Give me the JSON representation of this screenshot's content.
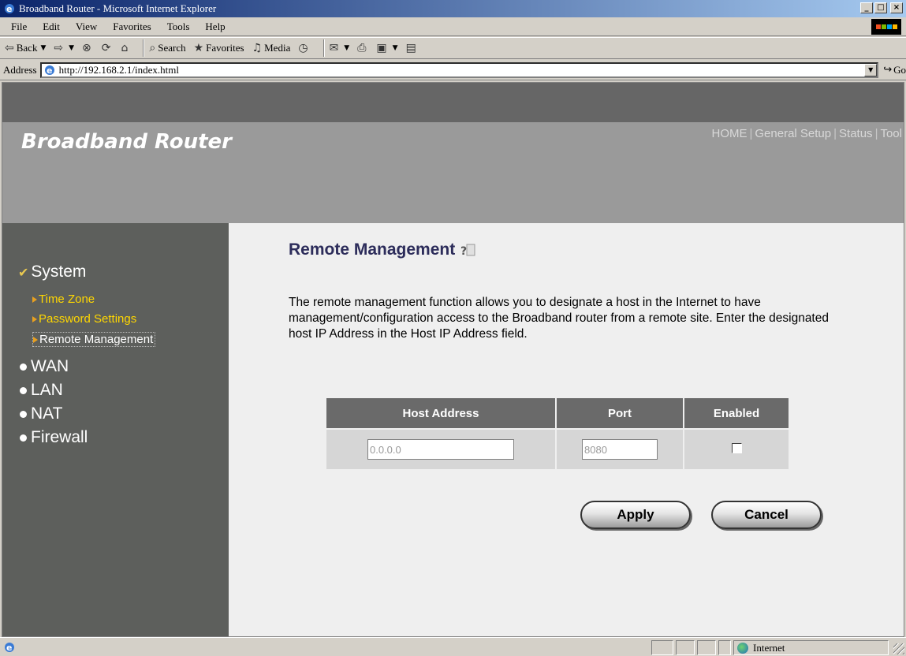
{
  "window": {
    "title": "Broadband Router - Microsoft Internet Explorer",
    "minimize": "_",
    "maximize": "□",
    "close": "×"
  },
  "menu": {
    "items": [
      "File",
      "Edit",
      "View",
      "Favorites",
      "Tools",
      "Help"
    ]
  },
  "toolbar": {
    "back": "Back",
    "search": "Search",
    "favorites": "Favorites",
    "media": "Media"
  },
  "address": {
    "label": "Address",
    "url": "http://192.168.2.1/index.html",
    "go": "Go"
  },
  "header": {
    "brand": "Broadband Router",
    "nav": [
      "HOME",
      "General Setup",
      "Status",
      "Tool"
    ]
  },
  "sidebar": {
    "system": "System",
    "sub_items": [
      "Time Zone",
      "Password Settings",
      "Remote Management"
    ],
    "active_sub": "Remote Management",
    "sections": [
      "WAN",
      "LAN",
      "NAT",
      "Firewall"
    ]
  },
  "content": {
    "title": "Remote Management",
    "description": "The remote management function allows you to designate a host in the Internet to have management/configuration access to the Broadband router from a remote site. Enter the designated host IP Address in the Host IP Address field.",
    "table": {
      "headers": [
        "Host Address",
        "Port",
        "Enabled"
      ],
      "host_address": "0.0.0.0",
      "port": "8080",
      "enabled": false
    },
    "apply": "Apply",
    "cancel": "Cancel"
  },
  "statusbar": {
    "zone": "Internet"
  },
  "colors": {
    "header_bg": "#9a9a9a",
    "sidebar_bg": "#5d5f5c",
    "submenu": "#ffd700",
    "title_color": "#2c2c5a",
    "table_header_bg": "#6a6a6a"
  }
}
